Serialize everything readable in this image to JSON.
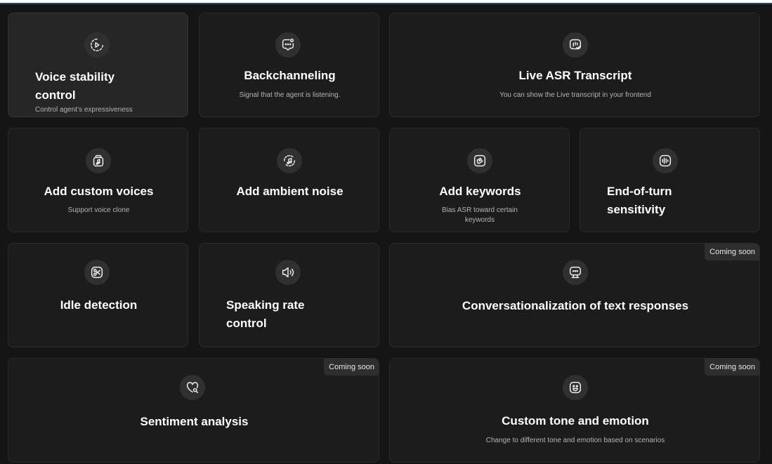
{
  "features": {
    "voice_stability": {
      "title": "Voice stability control",
      "description": "Control agent’s expressiveness",
      "icon": "play-circle-icon"
    },
    "backchanneling": {
      "title": "Backchanneling",
      "description": "Signal that the agent is listening.",
      "icon": "chat-bubble-icon"
    },
    "live_asr": {
      "title": "Live ASR Transcript",
      "description": "You can show the Live transcript in your frontend",
      "icon": "transcript-icon"
    },
    "custom_voices": {
      "title": "Add custom voices",
      "description": "Support voice clone",
      "icon": "music-note-icon"
    },
    "ambient_noise": {
      "title": "Add ambient noise",
      "icon": "music-rotate-icon"
    },
    "keywords": {
      "title": "Add keywords",
      "description": "Bias ASR toward certain keywords",
      "icon": "tag-icon"
    },
    "end_of_turn": {
      "title": "End-of-turn sensitivity",
      "icon": "waveform-icon"
    },
    "idle_detection": {
      "title": "Idle detection",
      "icon": "scissors-icon"
    },
    "speaking_rate": {
      "title": "Speaking rate control",
      "icon": "speaker-icon"
    },
    "conversationalization": {
      "title": "Conversationalization of text responses",
      "icon": "monitor-chat-icon",
      "badge": "Coming soon"
    },
    "sentiment": {
      "title": "Sentiment analysis",
      "icon": "heart-search-icon",
      "badge": "Coming soon"
    },
    "custom_tone": {
      "title": "Custom tone and emotion",
      "description": "Change to  different tone and emotion based on scenarios",
      "icon": "smiley-icon",
      "badge": "Coming soon"
    }
  }
}
